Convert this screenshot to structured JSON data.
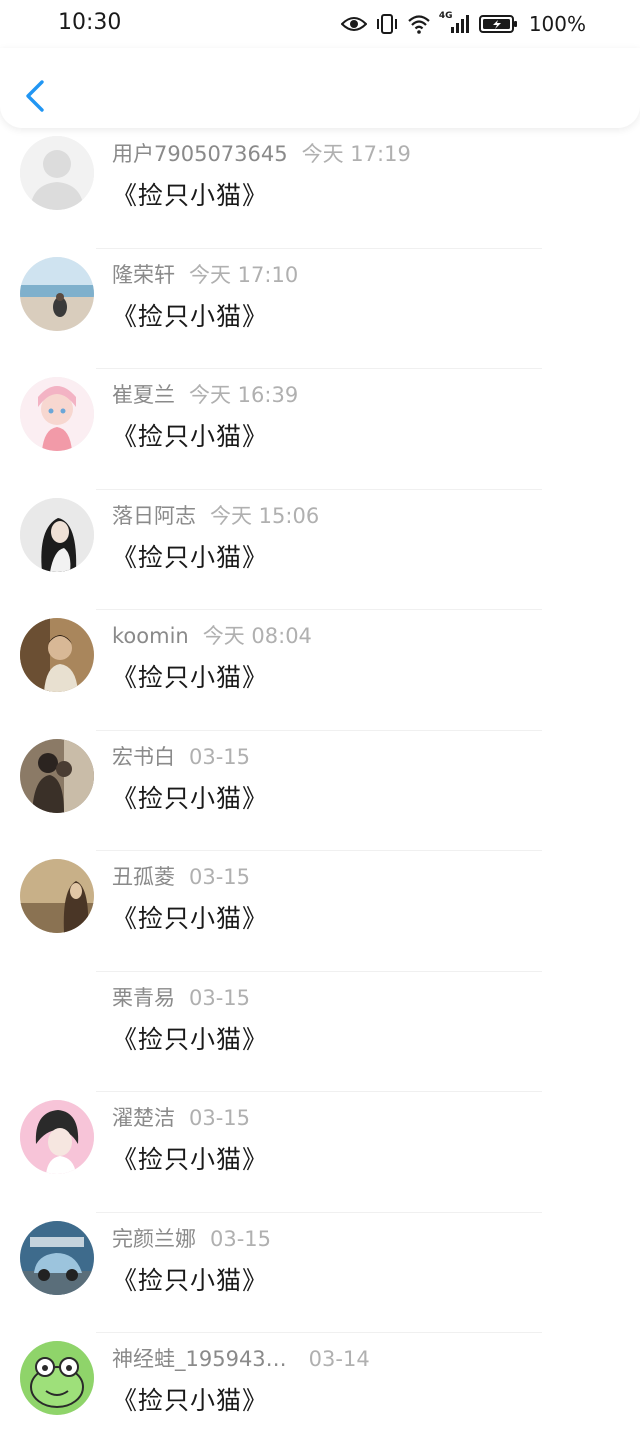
{
  "status_bar": {
    "time": "10:30",
    "network": "4G",
    "battery": "100%",
    "icons": [
      "eye-icon",
      "vibrate-icon",
      "wifi-icon",
      "signal-icon",
      "battery-icon"
    ]
  },
  "header": {
    "back_icon": "chevron-left-icon",
    "accent": "#2196F3"
  },
  "items": [
    {
      "name": "用户7905073645",
      "time": "今天 17:19",
      "title": "《捡只小猫》",
      "avatar": "default-avatar"
    },
    {
      "name": "隆荣轩",
      "time": "今天 17:10",
      "title": "《捡只小猫》",
      "avatar": "beach-avatar"
    },
    {
      "name": "崔夏兰",
      "time": "今天 16:39",
      "title": "《捡只小猫》",
      "avatar": "anime-girl-avatar"
    },
    {
      "name": "落日阿志",
      "time": "今天 15:06",
      "title": "《捡只小猫》",
      "avatar": "dark-hair-girl-avatar"
    },
    {
      "name": "koomin",
      "time": "今天 08:04",
      "title": "《捡只小猫》",
      "avatar": "boy-avatar"
    },
    {
      "name": "宏书白",
      "time": "03-15",
      "title": "《捡只小猫》",
      "avatar": "couple-avatar"
    },
    {
      "name": "丑孤菱",
      "time": "03-15",
      "title": "《捡只小猫》",
      "avatar": "sepia-girl-avatar"
    },
    {
      "name": "栗青易",
      "time": "03-15",
      "title": "《捡只小猫》",
      "avatar": ""
    },
    {
      "name": "濯楚洁",
      "time": "03-15",
      "title": "《捡只小猫》",
      "avatar": "pink-girl-avatar"
    },
    {
      "name": "完颜兰娜",
      "time": "03-15",
      "title": "《捡只小猫》",
      "avatar": "car-avatar"
    },
    {
      "name": "神经蛙_195943…",
      "time": "03-14",
      "title": "《捡只小猫》",
      "avatar": "frog-avatar"
    }
  ]
}
